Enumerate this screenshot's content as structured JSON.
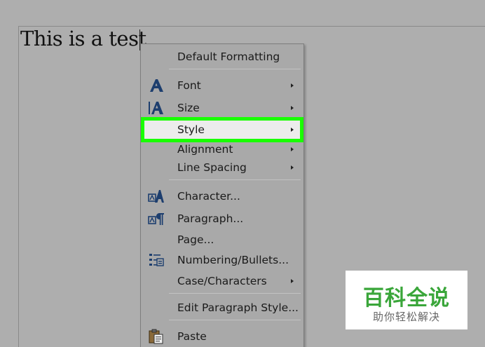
{
  "document": {
    "text": "This is a test"
  },
  "menu": {
    "items": [
      {
        "label": "Default Formatting",
        "icon": ""
      },
      {
        "label": "Font",
        "icon": "font-icon",
        "submenu": true
      },
      {
        "label": "Size",
        "icon": "font-size-icon",
        "submenu": true
      },
      {
        "label": "Style",
        "icon": "",
        "submenu": true,
        "highlighted": true
      },
      {
        "label": "Alignment",
        "icon": "",
        "submenu": true
      },
      {
        "label": "Line Spacing",
        "icon": "",
        "submenu": true
      },
      {
        "label": "Character...",
        "icon": "character-icon"
      },
      {
        "label": "Paragraph...",
        "icon": "paragraph-icon"
      },
      {
        "label": "Page...",
        "icon": ""
      },
      {
        "label": "Numbering/Bullets...",
        "icon": "numbering-icon"
      },
      {
        "label": "Case/Characters",
        "icon": "",
        "submenu": true
      },
      {
        "label": "Edit Paragraph Style...",
        "icon": ""
      },
      {
        "label": "Paste",
        "icon": "paste-icon"
      }
    ]
  },
  "colors": {
    "highlight_border": "#19ff00",
    "watermark_green": "#3aa63a"
  },
  "watermark": {
    "main": "百科全说",
    "sub": "助你轻松解决"
  }
}
